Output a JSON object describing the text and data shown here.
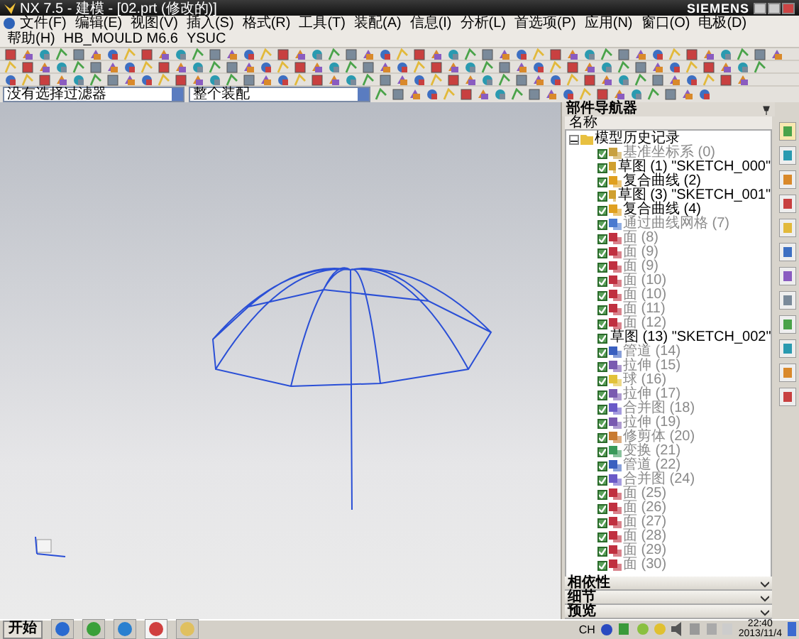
{
  "window": {
    "title": "NX 7.5 - 建模 - [02.prt (修改的)]",
    "brand": "SIEMENS"
  },
  "menu": [
    "文件(F)",
    "编辑(E)",
    "视图(V)",
    "插入(S)",
    "格式(R)",
    "工具(T)",
    "装配(A)",
    "信息(I)",
    "分析(L)",
    "首选项(P)",
    "应用(N)",
    "窗口(O)",
    "电极(D)",
    "帮助(H)",
    "HB_MOULD M6.6",
    "YSUC"
  ],
  "selection_bar": {
    "filter": "没有选择过滤器",
    "scope": "整个装配"
  },
  "navigator": {
    "title": "部件导航器",
    "column": "名称",
    "tree": [
      {
        "label": "模型历史记录",
        "expanded": true,
        "children": [
          {
            "label": "基准坐标系 (0)",
            "checked": true,
            "dimmed": true,
            "kind": "datum"
          },
          {
            "label": "草图 (1) \"SKETCH_000\"",
            "checked": true,
            "dimmed": false,
            "kind": "sketch"
          },
          {
            "label": "复合曲线 (2)",
            "checked": true,
            "dimmed": false,
            "kind": "curve"
          },
          {
            "label": "草图 (3) \"SKETCH_001\"",
            "checked": true,
            "dimmed": false,
            "kind": "sketch"
          },
          {
            "label": "复合曲线 (4)",
            "checked": true,
            "dimmed": false,
            "kind": "curve"
          },
          {
            "label": "通过曲线网格 (7)",
            "checked": true,
            "dimmed": true,
            "kind": "surface"
          },
          {
            "label": "面 (8)",
            "checked": true,
            "dimmed": true,
            "kind": "face"
          },
          {
            "label": "面 (9)",
            "checked": true,
            "dimmed": true,
            "kind": "face"
          },
          {
            "label": "面 (9)",
            "checked": true,
            "dimmed": true,
            "kind": "face"
          },
          {
            "label": "面 (10)",
            "checked": true,
            "dimmed": true,
            "kind": "face"
          },
          {
            "label": "面 (10)",
            "checked": true,
            "dimmed": true,
            "kind": "face"
          },
          {
            "label": "面 (11)",
            "checked": true,
            "dimmed": true,
            "kind": "face"
          },
          {
            "label": "面 (12)",
            "checked": true,
            "dimmed": true,
            "kind": "face"
          },
          {
            "label": "草图 (13) \"SKETCH_002\"",
            "checked": true,
            "dimmed": false,
            "kind": "sketch"
          },
          {
            "label": "管道 (14)",
            "checked": true,
            "dimmed": true,
            "kind": "tube"
          },
          {
            "label": "拉伸 (15)",
            "checked": true,
            "dimmed": true,
            "kind": "extrude"
          },
          {
            "label": "球 (16)",
            "checked": true,
            "dimmed": true,
            "kind": "sphere"
          },
          {
            "label": "拉伸 (17)",
            "checked": true,
            "dimmed": true,
            "kind": "extrude"
          },
          {
            "label": "合并图 (18)",
            "checked": true,
            "dimmed": true,
            "kind": "boolean"
          },
          {
            "label": "拉伸 (19)",
            "checked": true,
            "dimmed": true,
            "kind": "extrude"
          },
          {
            "label": "修剪体 (20)",
            "checked": true,
            "dimmed": true,
            "kind": "trim"
          },
          {
            "label": "变换 (21)",
            "checked": true,
            "dimmed": true,
            "kind": "transform"
          },
          {
            "label": "管道 (22)",
            "checked": true,
            "dimmed": true,
            "kind": "tube"
          },
          {
            "label": "合并图 (24)",
            "checked": true,
            "dimmed": true,
            "kind": "boolean"
          },
          {
            "label": "面 (25)",
            "checked": true,
            "dimmed": true,
            "kind": "face"
          },
          {
            "label": "面 (26)",
            "checked": true,
            "dimmed": true,
            "kind": "face"
          },
          {
            "label": "面 (27)",
            "checked": true,
            "dimmed": true,
            "kind": "face"
          },
          {
            "label": "面 (28)",
            "checked": true,
            "dimmed": true,
            "kind": "face"
          },
          {
            "label": "面 (29)",
            "checked": true,
            "dimmed": true,
            "kind": "face"
          },
          {
            "label": "面 (30)",
            "checked": true,
            "dimmed": true,
            "kind": "face"
          }
        ]
      }
    ],
    "panels": [
      {
        "label": "相依性",
        "expanded": false
      },
      {
        "label": "细节",
        "expanded": false
      },
      {
        "label": "预览",
        "expanded": false
      }
    ]
  },
  "taskbar": {
    "start": "开始",
    "language": "CH",
    "time": "22:40",
    "date": "2013/11/4"
  }
}
